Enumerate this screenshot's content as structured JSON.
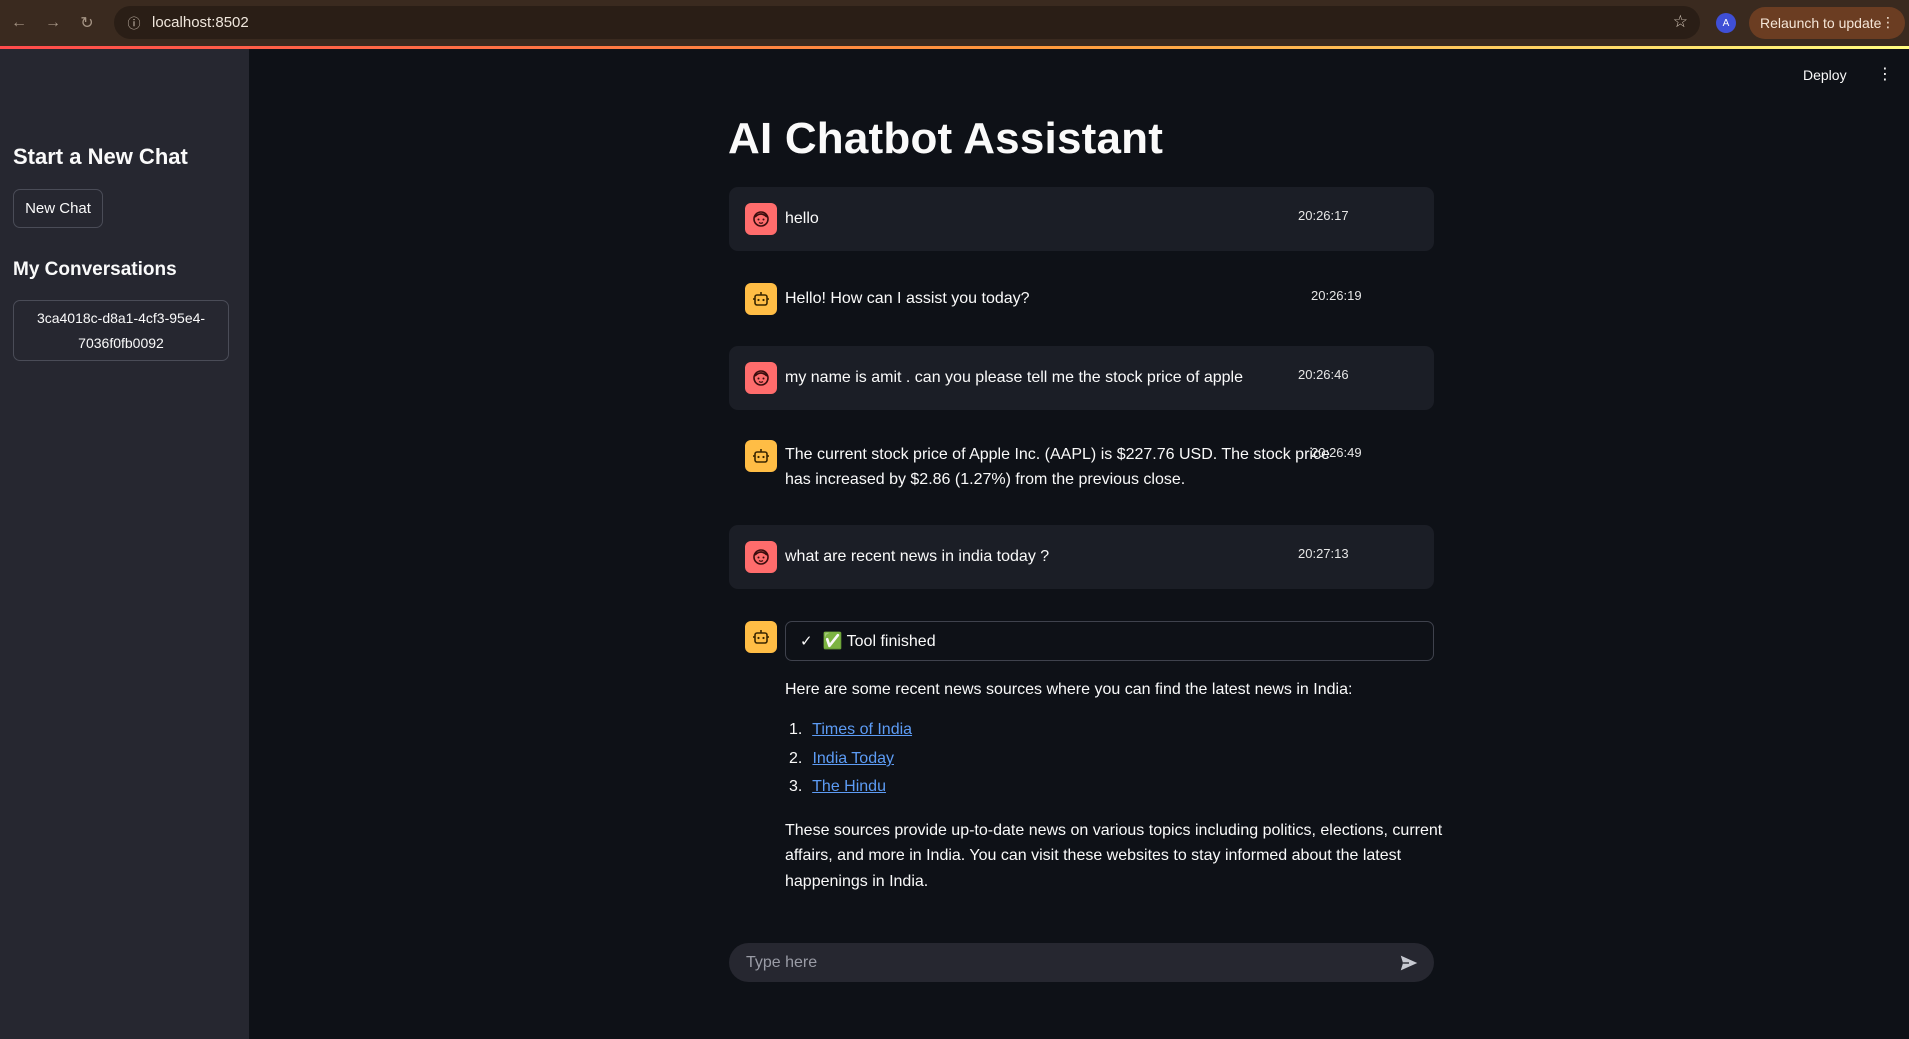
{
  "browser": {
    "url": "localhost:8502",
    "profile_initial": "A",
    "relaunch_label": "Relaunch to update"
  },
  "header": {
    "deploy_label": "Deploy"
  },
  "sidebar": {
    "title": "Start a New Chat",
    "new_chat_label": "New Chat",
    "conversations_title": "My Conversations",
    "conversations": [
      "3ca4018c-d8a1-4cf3-95e4-7036f0fb0092"
    ]
  },
  "main": {
    "title": "AI Chatbot Assistant",
    "messages": [
      {
        "role": "user",
        "text": "hello",
        "time": "20:26:17"
      },
      {
        "role": "assistant",
        "text": "Hello! How can I assist you today?",
        "time": "20:26:19"
      },
      {
        "role": "user",
        "text": "my name is amit . can you please tell me the stock price of  apple",
        "time": "20:26:46"
      },
      {
        "role": "assistant",
        "text_line1": "The current stock price of Apple Inc. (AAPL) is $227.76 USD. The stock price",
        "text_line2": "has increased by $2.86 (1.27%) from the previous close.",
        "time": "20:26:49"
      },
      {
        "role": "user",
        "text": "what are recent news in india today ?",
        "time": "20:27:13"
      }
    ],
    "last_response": {
      "status": "✅ Tool finished",
      "intro": "Here are some recent news sources where you can find the latest news in India:",
      "links": [
        {
          "num": "1.",
          "label": "Times of India"
        },
        {
          "num": "2.",
          "label": "India Today"
        },
        {
          "num": "3.",
          "label": "The Hindu"
        }
      ],
      "outro_line1": "These sources provide up-to-date news on various topics including politics, elections, current",
      "outro_line2": "affairs, and more in India. You can visit these websites to stay informed about the latest",
      "outro_line3": "happenings in India."
    },
    "input_placeholder": "Type here"
  },
  "colors": {
    "background": "#0e1117",
    "sidebar": "#262730",
    "user_avatar": "#ff6c6c",
    "bot_avatar": "#ffbd45",
    "link": "#5d9cf5"
  }
}
